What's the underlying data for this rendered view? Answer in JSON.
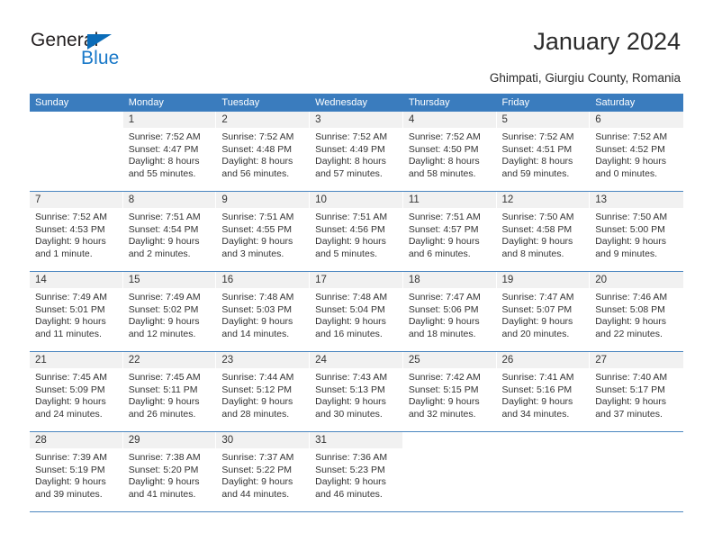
{
  "brand": {
    "name_part1": "General",
    "name_part2": "Blue",
    "triangle_color": "#0b6cb8",
    "text_color": "#231f20",
    "blue_color": "#1878c8"
  },
  "header": {
    "title": "January 2024",
    "subtitle": "Ghimpati, Giurgiu County, Romania"
  },
  "theme": {
    "header_bg": "#3a7cbe",
    "header_text": "#ffffff",
    "daynum_band": "#f1f1f1",
    "row_divider": "#4a86c0"
  },
  "weekdays": [
    "Sunday",
    "Monday",
    "Tuesday",
    "Wednesday",
    "Thursday",
    "Friday",
    "Saturday"
  ],
  "weeks": [
    {
      "days": [
        {
          "num": "",
          "blank": true,
          "sunrise": "",
          "sunset": "",
          "daylight1": "",
          "daylight2": ""
        },
        {
          "num": "1",
          "sunrise": "Sunrise: 7:52 AM",
          "sunset": "Sunset: 4:47 PM",
          "daylight1": "Daylight: 8 hours",
          "daylight2": "and 55 minutes."
        },
        {
          "num": "2",
          "sunrise": "Sunrise: 7:52 AM",
          "sunset": "Sunset: 4:48 PM",
          "daylight1": "Daylight: 8 hours",
          "daylight2": "and 56 minutes."
        },
        {
          "num": "3",
          "sunrise": "Sunrise: 7:52 AM",
          "sunset": "Sunset: 4:49 PM",
          "daylight1": "Daylight: 8 hours",
          "daylight2": "and 57 minutes."
        },
        {
          "num": "4",
          "sunrise": "Sunrise: 7:52 AM",
          "sunset": "Sunset: 4:50 PM",
          "daylight1": "Daylight: 8 hours",
          "daylight2": "and 58 minutes."
        },
        {
          "num": "5",
          "sunrise": "Sunrise: 7:52 AM",
          "sunset": "Sunset: 4:51 PM",
          "daylight1": "Daylight: 8 hours",
          "daylight2": "and 59 minutes."
        },
        {
          "num": "6",
          "sunrise": "Sunrise: 7:52 AM",
          "sunset": "Sunset: 4:52 PM",
          "daylight1": "Daylight: 9 hours",
          "daylight2": "and 0 minutes."
        }
      ]
    },
    {
      "days": [
        {
          "num": "7",
          "sunrise": "Sunrise: 7:52 AM",
          "sunset": "Sunset: 4:53 PM",
          "daylight1": "Daylight: 9 hours",
          "daylight2": "and 1 minute."
        },
        {
          "num": "8",
          "sunrise": "Sunrise: 7:51 AM",
          "sunset": "Sunset: 4:54 PM",
          "daylight1": "Daylight: 9 hours",
          "daylight2": "and 2 minutes."
        },
        {
          "num": "9",
          "sunrise": "Sunrise: 7:51 AM",
          "sunset": "Sunset: 4:55 PM",
          "daylight1": "Daylight: 9 hours",
          "daylight2": "and 3 minutes."
        },
        {
          "num": "10",
          "sunrise": "Sunrise: 7:51 AM",
          "sunset": "Sunset: 4:56 PM",
          "daylight1": "Daylight: 9 hours",
          "daylight2": "and 5 minutes."
        },
        {
          "num": "11",
          "sunrise": "Sunrise: 7:51 AM",
          "sunset": "Sunset: 4:57 PM",
          "daylight1": "Daylight: 9 hours",
          "daylight2": "and 6 minutes."
        },
        {
          "num": "12",
          "sunrise": "Sunrise: 7:50 AM",
          "sunset": "Sunset: 4:58 PM",
          "daylight1": "Daylight: 9 hours",
          "daylight2": "and 8 minutes."
        },
        {
          "num": "13",
          "sunrise": "Sunrise: 7:50 AM",
          "sunset": "Sunset: 5:00 PM",
          "daylight1": "Daylight: 9 hours",
          "daylight2": "and 9 minutes."
        }
      ]
    },
    {
      "days": [
        {
          "num": "14",
          "sunrise": "Sunrise: 7:49 AM",
          "sunset": "Sunset: 5:01 PM",
          "daylight1": "Daylight: 9 hours",
          "daylight2": "and 11 minutes."
        },
        {
          "num": "15",
          "sunrise": "Sunrise: 7:49 AM",
          "sunset": "Sunset: 5:02 PM",
          "daylight1": "Daylight: 9 hours",
          "daylight2": "and 12 minutes."
        },
        {
          "num": "16",
          "sunrise": "Sunrise: 7:48 AM",
          "sunset": "Sunset: 5:03 PM",
          "daylight1": "Daylight: 9 hours",
          "daylight2": "and 14 minutes."
        },
        {
          "num": "17",
          "sunrise": "Sunrise: 7:48 AM",
          "sunset": "Sunset: 5:04 PM",
          "daylight1": "Daylight: 9 hours",
          "daylight2": "and 16 minutes."
        },
        {
          "num": "18",
          "sunrise": "Sunrise: 7:47 AM",
          "sunset": "Sunset: 5:06 PM",
          "daylight1": "Daylight: 9 hours",
          "daylight2": "and 18 minutes."
        },
        {
          "num": "19",
          "sunrise": "Sunrise: 7:47 AM",
          "sunset": "Sunset: 5:07 PM",
          "daylight1": "Daylight: 9 hours",
          "daylight2": "and 20 minutes."
        },
        {
          "num": "20",
          "sunrise": "Sunrise: 7:46 AM",
          "sunset": "Sunset: 5:08 PM",
          "daylight1": "Daylight: 9 hours",
          "daylight2": "and 22 minutes."
        }
      ]
    },
    {
      "days": [
        {
          "num": "21",
          "sunrise": "Sunrise: 7:45 AM",
          "sunset": "Sunset: 5:09 PM",
          "daylight1": "Daylight: 9 hours",
          "daylight2": "and 24 minutes."
        },
        {
          "num": "22",
          "sunrise": "Sunrise: 7:45 AM",
          "sunset": "Sunset: 5:11 PM",
          "daylight1": "Daylight: 9 hours",
          "daylight2": "and 26 minutes."
        },
        {
          "num": "23",
          "sunrise": "Sunrise: 7:44 AM",
          "sunset": "Sunset: 5:12 PM",
          "daylight1": "Daylight: 9 hours",
          "daylight2": "and 28 minutes."
        },
        {
          "num": "24",
          "sunrise": "Sunrise: 7:43 AM",
          "sunset": "Sunset: 5:13 PM",
          "daylight1": "Daylight: 9 hours",
          "daylight2": "and 30 minutes."
        },
        {
          "num": "25",
          "sunrise": "Sunrise: 7:42 AM",
          "sunset": "Sunset: 5:15 PM",
          "daylight1": "Daylight: 9 hours",
          "daylight2": "and 32 minutes."
        },
        {
          "num": "26",
          "sunrise": "Sunrise: 7:41 AM",
          "sunset": "Sunset: 5:16 PM",
          "daylight1": "Daylight: 9 hours",
          "daylight2": "and 34 minutes."
        },
        {
          "num": "27",
          "sunrise": "Sunrise: 7:40 AM",
          "sunset": "Sunset: 5:17 PM",
          "daylight1": "Daylight: 9 hours",
          "daylight2": "and 37 minutes."
        }
      ]
    },
    {
      "days": [
        {
          "num": "28",
          "sunrise": "Sunrise: 7:39 AM",
          "sunset": "Sunset: 5:19 PM",
          "daylight1": "Daylight: 9 hours",
          "daylight2": "and 39 minutes."
        },
        {
          "num": "29",
          "sunrise": "Sunrise: 7:38 AM",
          "sunset": "Sunset: 5:20 PM",
          "daylight1": "Daylight: 9 hours",
          "daylight2": "and 41 minutes."
        },
        {
          "num": "30",
          "sunrise": "Sunrise: 7:37 AM",
          "sunset": "Sunset: 5:22 PM",
          "daylight1": "Daylight: 9 hours",
          "daylight2": "and 44 minutes."
        },
        {
          "num": "31",
          "sunrise": "Sunrise: 7:36 AM",
          "sunset": "Sunset: 5:23 PM",
          "daylight1": "Daylight: 9 hours",
          "daylight2": "and 46 minutes."
        },
        {
          "num": "",
          "blank": true,
          "sunrise": "",
          "sunset": "",
          "daylight1": "",
          "daylight2": ""
        },
        {
          "num": "",
          "blank": true,
          "sunrise": "",
          "sunset": "",
          "daylight1": "",
          "daylight2": ""
        },
        {
          "num": "",
          "blank": true,
          "sunrise": "",
          "sunset": "",
          "daylight1": "",
          "daylight2": ""
        }
      ]
    }
  ]
}
